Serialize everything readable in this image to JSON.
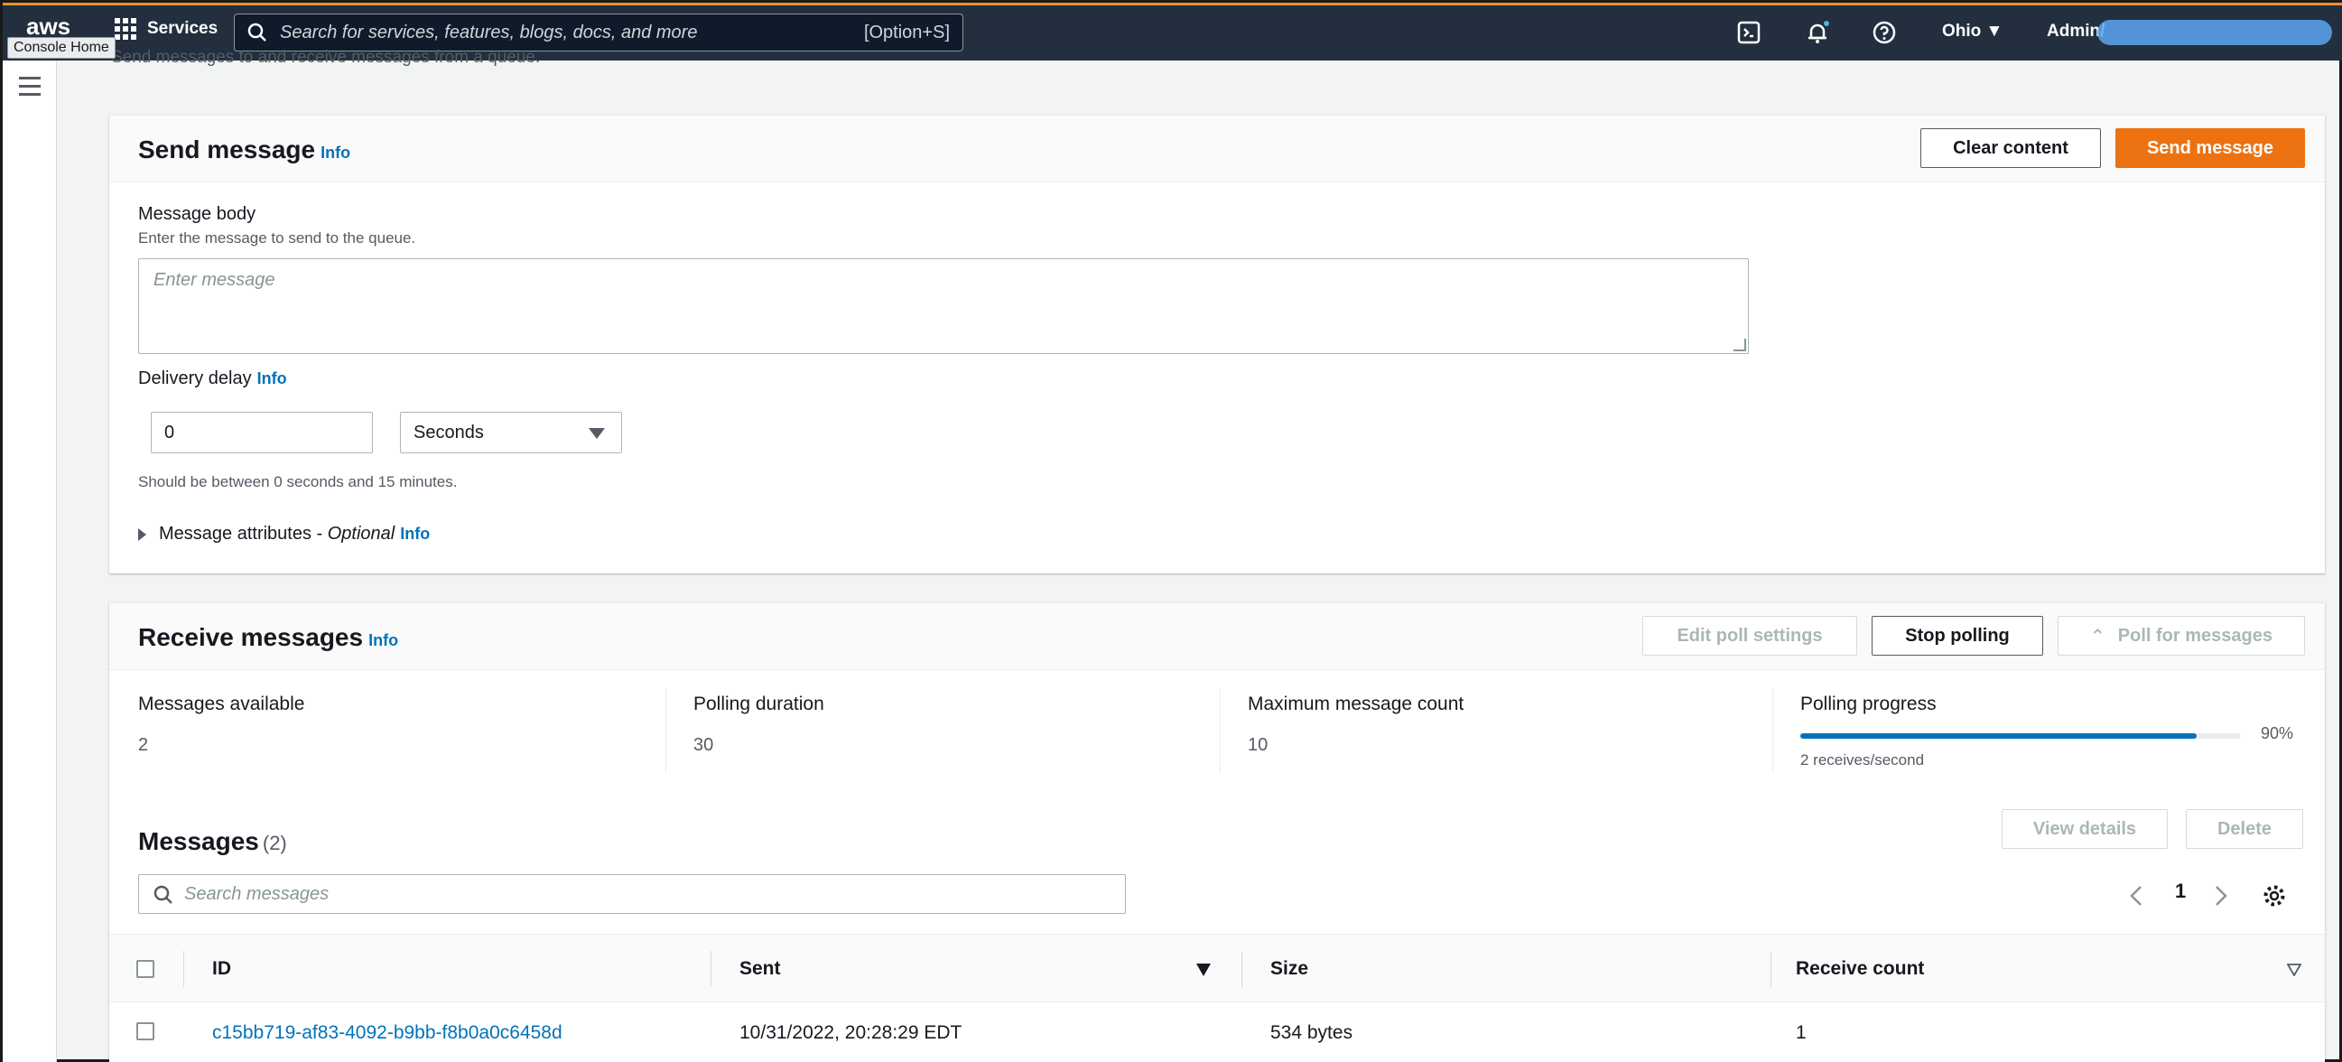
{
  "nav": {
    "logo": "aws",
    "tooltip": "Console Home",
    "services": "Services",
    "search_placeholder": "Search for services, features, blogs, docs, and more",
    "search_shortcut": "[Option+S]",
    "region": "Ohio ▼",
    "account": "Admin/"
  },
  "page": {
    "cut_description": "Send messages to and receive messages from a queue."
  },
  "send": {
    "title": "Send message",
    "info": "Info",
    "clear_button": "Clear content",
    "send_button": "Send message",
    "body_label": "Message body",
    "body_hint": "Enter the message to send to the queue.",
    "body_placeholder": "Enter message",
    "delay_label": "Delivery delay",
    "delay_info": "Info",
    "delay_value": "0",
    "delay_unit": "Seconds",
    "delay_hint": "Should be between 0 seconds and 15 minutes.",
    "attributes_label": "Message attributes - ",
    "attributes_optional": "Optional",
    "attributes_info": "Info"
  },
  "receive": {
    "title": "Receive messages",
    "info": "Info",
    "edit_button": "Edit poll settings",
    "stop_button": "Stop polling",
    "poll_button": "Poll for messages",
    "stats": {
      "available_label": "Messages available",
      "available_value": "2",
      "duration_label": "Polling duration",
      "duration_value": "30",
      "max_label": "Maximum message count",
      "max_value": "10",
      "progress_label": "Polling progress",
      "progress_value": 0.9,
      "progress_percent": "90%",
      "progress_rate": "2 receives/second"
    },
    "messages": {
      "title": "Messages",
      "count": "(2)",
      "view_button": "View details",
      "delete_button": "Delete",
      "search_placeholder": "Search messages",
      "page": "1",
      "columns": [
        "ID",
        "Sent",
        "Size",
        "Receive count"
      ],
      "rows": [
        {
          "id": "c15bb719-af83-4092-b9bb-f8b0a0c6458d",
          "sent": "10/31/2022, 20:28:29 EDT",
          "size": "534 bytes",
          "receive_count": "1"
        }
      ]
    }
  }
}
